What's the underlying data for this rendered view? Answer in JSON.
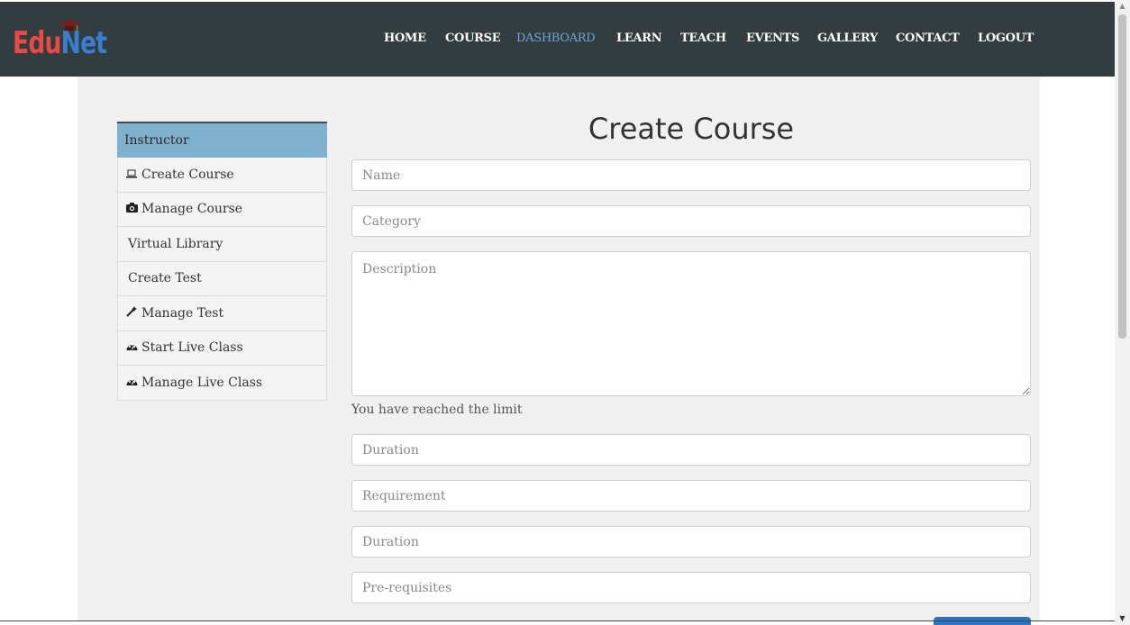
{
  "brand": {
    "part1": "Edu",
    "part2": "Net"
  },
  "nav": [
    {
      "label": "HOME",
      "active": false
    },
    {
      "label": "COURSE",
      "active": false
    },
    {
      "label": "DASHBOARD",
      "active": true
    },
    {
      "label": "LEARN",
      "active": false
    },
    {
      "label": "TEACH",
      "active": false
    },
    {
      "label": "EVENTS",
      "active": false
    },
    {
      "label": "GALLERY",
      "active": false
    },
    {
      "label": "CONTACT",
      "active": false
    },
    {
      "label": "LOGOUT",
      "active": false
    }
  ],
  "sidebar": {
    "heading": "Instructor",
    "items": [
      {
        "label": "Create Course",
        "icon": "laptop-icon"
      },
      {
        "label": "Manage Course",
        "icon": "camera-icon"
      },
      {
        "label": "Virtual Library",
        "icon": ""
      },
      {
        "label": "Create Test",
        "icon": ""
      },
      {
        "label": "Manage Test",
        "icon": "magic-wand-icon"
      },
      {
        "label": "Start Live Class",
        "icon": "dashboard-icon"
      },
      {
        "label": "Manage Live Class",
        "icon": "dashboard-icon"
      }
    ]
  },
  "form": {
    "title": "Create Course",
    "name_placeholder": "Name",
    "category_placeholder": "Category",
    "description_placeholder": "Description",
    "limit_message": "You have reached the limit",
    "duration_placeholder": "Duration",
    "requirement_placeholder": "Requirement",
    "duration2_placeholder": "Duration",
    "prerequisites_placeholder": "Pre-requisites"
  },
  "colors": {
    "topbar": "#333c3f",
    "nav_active": "#6ea6d6",
    "sidebar_heading": "#7fb1cf",
    "submit": "#2b73c2"
  }
}
